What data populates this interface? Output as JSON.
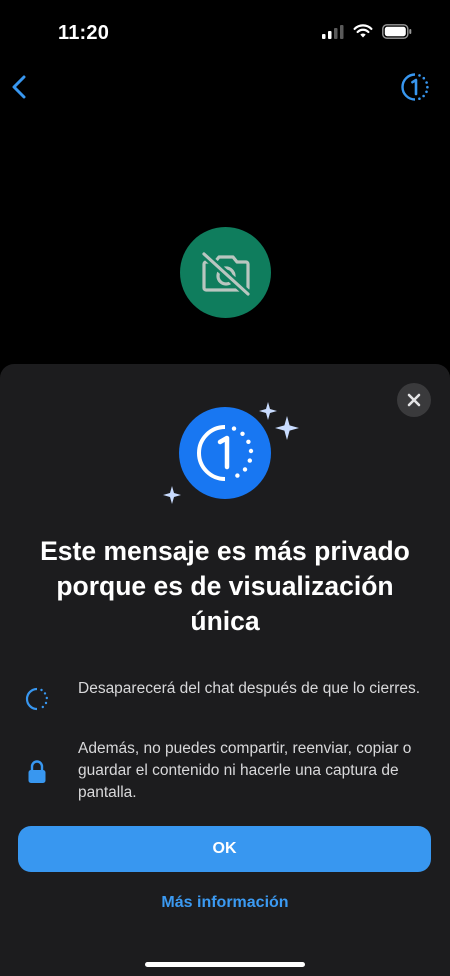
{
  "status_bar": {
    "time": "11:20"
  },
  "nav": {
    "back_icon": "chevron-left-icon",
    "view_once_icon": "view-once-icon",
    "accent_color": "#3897f0"
  },
  "media": {
    "icon": "camera-off-icon",
    "badge_color": "#0f7d5d"
  },
  "sheet": {
    "hero_icon": "view-once-icon",
    "hero_color": "#1877f2",
    "title": "Este mensaje es más privado porque es de visualización única",
    "items": [
      {
        "icon": "dashed-circle-icon",
        "text": "Desaparecerá del chat después de que lo cierres."
      },
      {
        "icon": "lock-icon",
        "text": "Además, no puedes compartir, reenviar, copiar o guardar el contenido ni hacerle una captura de pantalla."
      }
    ],
    "ok_label": "OK",
    "more_info_label": "Más información",
    "button_color": "#3897f0",
    "link_color": "#3b9af2"
  }
}
